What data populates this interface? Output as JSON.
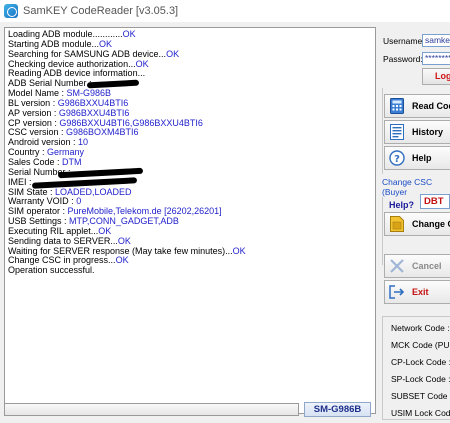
{
  "window": {
    "title": "SamKEY CodeReader [v3.05.3]"
  },
  "log": {
    "lines": [
      {
        "text": "Loading ADB module............",
        "value": "OK"
      },
      {
        "text": "Starting ADB module...",
        "value": "OK"
      },
      {
        "text": "Searching for SAMSUNG ADB device...",
        "value": "OK"
      },
      {
        "text": "Checking device authorization...",
        "value": "OK"
      },
      {
        "text": "Reading ADB device information...",
        "value": ""
      },
      {
        "text": "ADB Serial Number : ",
        "value": ""
      },
      {
        "text": "Model Name : ",
        "value": "SM-G986B"
      },
      {
        "text": "BL version : ",
        "value": "G986BXXU4BTI6"
      },
      {
        "text": "AP version : ",
        "value": "G986BXXU4BTI6"
      },
      {
        "text": "CP version : ",
        "value": "G986BXXU4BTI6,G986BXXU4BTI6"
      },
      {
        "text": "CSC version : ",
        "value": "G986BOXM4BTI6"
      },
      {
        "text": "Android version : ",
        "value": "10"
      },
      {
        "text": "Country : ",
        "value": "Germany"
      },
      {
        "text": "Sales Code : ",
        "value": "DTM"
      },
      {
        "text": "Serial Number : ",
        "value": ""
      },
      {
        "text": "IMEI : ",
        "value": ""
      },
      {
        "text": "SIM State : ",
        "value": "LOADED,LOADED"
      },
      {
        "text": "Warranty VOID : ",
        "value": "0"
      },
      {
        "text": "SIM operator : ",
        "value": "PureMobile,Telekom.de [26202,26201]"
      },
      {
        "text": "USB Settings : ",
        "value": "MTP,CONN_GADGET,ADB"
      },
      {
        "text": "Executing RIL applet...",
        "value": "OK"
      },
      {
        "text": "Sending data to SERVER...",
        "value": "OK"
      },
      {
        "text": "Waiting for SERVER response (May take few minutes)...",
        "value": "OK"
      },
      {
        "text": "Change CSC in progress...",
        "value": "OK"
      },
      {
        "text": "Operation successful.",
        "value": ""
      }
    ]
  },
  "status": {
    "model": "SM-G986B",
    "progress": 0
  },
  "login": {
    "username_label": "Username:",
    "username_value": "samkey",
    "password_label": "Password:",
    "password_value": "********",
    "login_label": "Log"
  },
  "actions": {
    "read_codes": "Read Codes",
    "history": "History",
    "help": "Help"
  },
  "csc": {
    "group_title": "Change CSC (Buyer",
    "help_label": "Help?",
    "value": "DBT",
    "change_button": "Change CSC"
  },
  "control": {
    "cancel": "Cancel",
    "exit": "Exit"
  },
  "codes": {
    "labels": [
      "Network Code :",
      "MCK Code (PUK) :",
      "CP-Lock Code :",
      "SP-Lock Code :",
      "SUBSET Code :",
      "USIM Lock Code :"
    ]
  },
  "colors": {
    "accent": "#2222cc",
    "danger": "#d01515",
    "group_title": "#1a4cc7"
  }
}
